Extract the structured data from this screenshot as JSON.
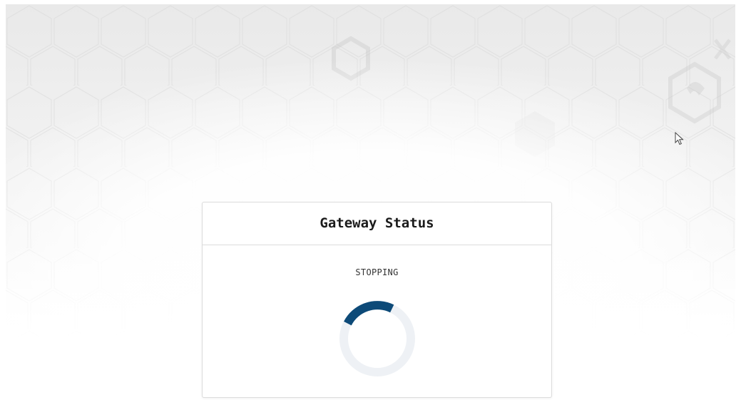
{
  "card": {
    "title": "Gateway Status",
    "status": "STOPPING"
  },
  "spinner": {
    "track_color": "#eef1f5",
    "arc_color": "#0d4a78"
  },
  "background": {
    "pattern_icon": "hexagon-pattern",
    "logo_icons": [
      "honeycomb-logo-icon",
      "close-x-icon"
    ]
  }
}
